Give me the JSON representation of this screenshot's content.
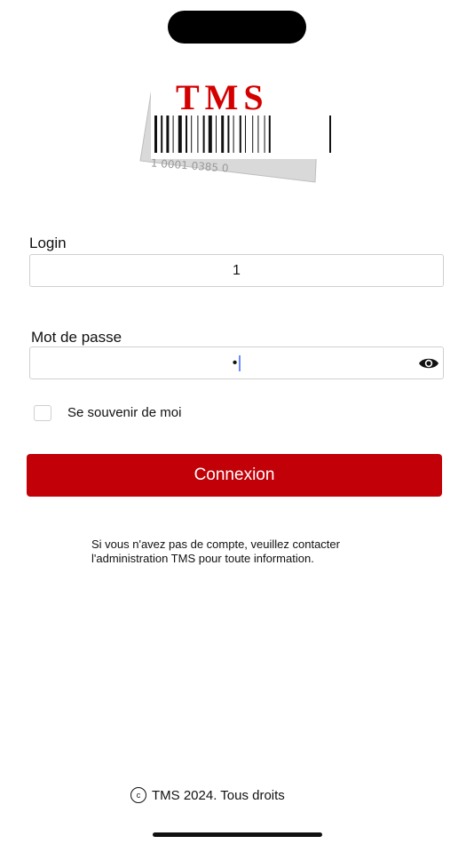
{
  "logo": {
    "brand_text": "TMS",
    "barcode_number": "1  0001  0385   0"
  },
  "form": {
    "login_label": "Login",
    "login_value": "1",
    "password_label": "Mot de passe",
    "password_masked": "•",
    "remember_label": "Se souvenir de moi",
    "remember_checked": false,
    "submit_label": "Connexion"
  },
  "info": {
    "line1": "Si vous n'avez pas de compte, veuillez contacter",
    "line2": "l'administration TMS pour toute information."
  },
  "footer": {
    "copyright_symbol": "c",
    "text": "TMS 2024. Tous droits"
  },
  "colors": {
    "accent": "#c10007",
    "logo_red": "#d40000"
  }
}
